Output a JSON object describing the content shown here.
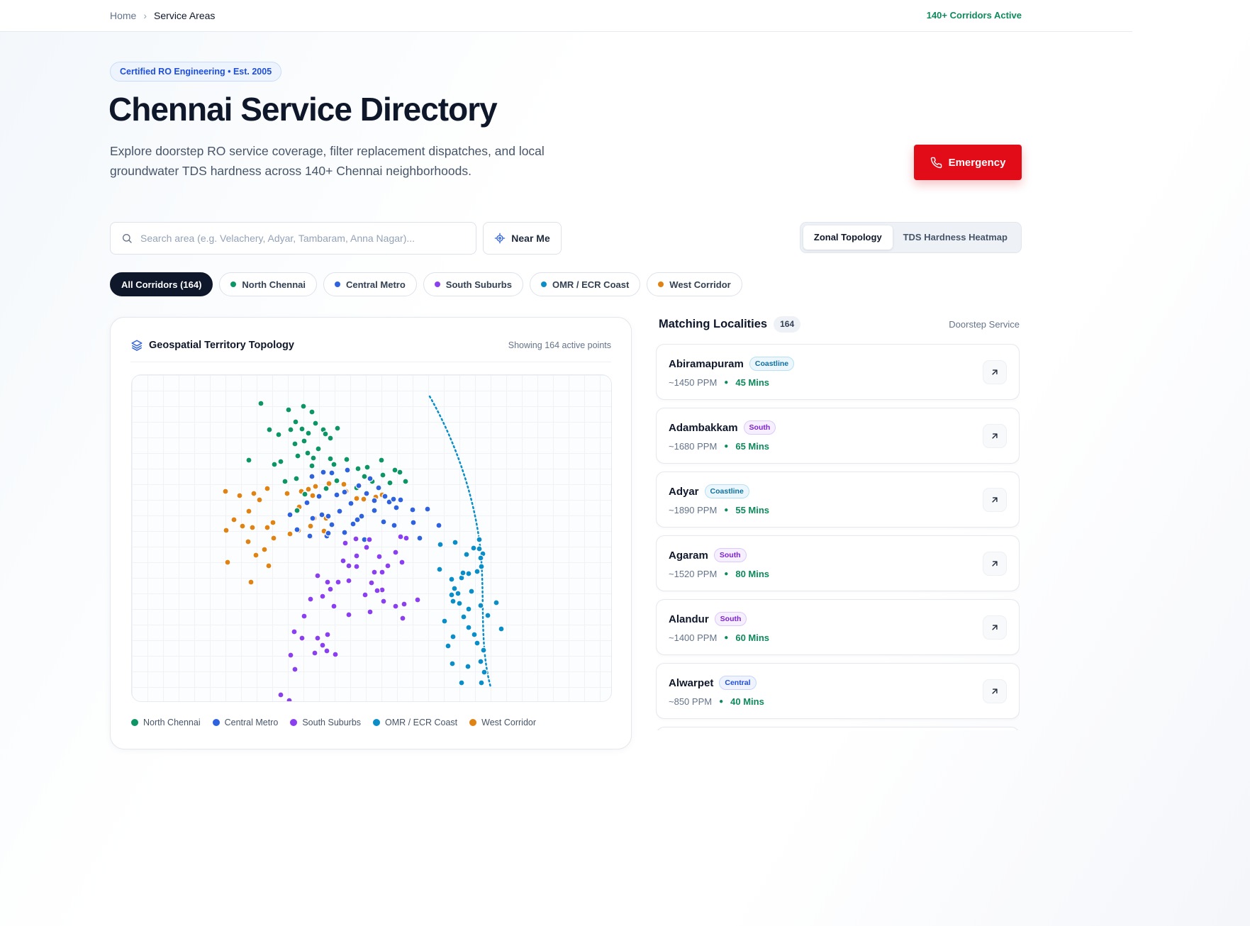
{
  "breadcrumb": {
    "home": "Home",
    "current": "Service Areas"
  },
  "top_status": "140+ Corridors Active",
  "hero": {
    "badge": "Certified RO Engineering • Est. 2005",
    "title": "Chennai Service Directory",
    "subtitle": "Explore doorstep RO service coverage, filter replacement dispatches, and local groundwater TDS hardness across 140+ Chennai neighborhoods.",
    "emergency_label": "Emergency"
  },
  "search": {
    "placeholder": "Search area (e.g. Velachery, Adyar, Tambaram, Anna Nagar)...",
    "value": "",
    "near_me_label": "Near Me"
  },
  "view_toggle": {
    "options": [
      "Zonal Topology",
      "TDS Hardness Heatmap"
    ],
    "selected": "Zonal Topology"
  },
  "filters": [
    {
      "label": "All Corridors (164)",
      "active": true
    },
    {
      "label": "North Chennai",
      "color": "#0e9566"
    },
    {
      "label": "Central Metro",
      "color": "#2f62de"
    },
    {
      "label": "South Suburbs",
      "color": "#8a3ff0"
    },
    {
      "label": "OMR / ECR Coast",
      "color": "#0b8ec8"
    },
    {
      "label": "West Corridor",
      "color": "#de8314"
    }
  ],
  "map": {
    "title": "Geospatial Territory Topology",
    "count_label": "Showing 164 active points",
    "icon": "layers-icon",
    "legend": [
      {
        "label": "North Chennai",
        "color": "#0e9566"
      },
      {
        "label": "Central Metro",
        "color": "#2f62de"
      },
      {
        "label": "South Suburbs",
        "color": "#8a3ff0"
      },
      {
        "label": "OMR / ECR Coast",
        "color": "#0b8ec8"
      },
      {
        "label": "West Corridor",
        "color": "#de8314"
      }
    ]
  },
  "localities": {
    "title": "Matching Localities",
    "count": "164",
    "service_label": "Doorstep Service",
    "items": [
      {
        "name": "Abiramapuram",
        "tag": "Coastline",
        "tag_type": "coast",
        "ppm": "~1450 PPM",
        "eta": "45 Mins"
      },
      {
        "name": "Adambakkam",
        "tag": "South",
        "tag_type": "south",
        "ppm": "~1680 PPM",
        "eta": "65 Mins"
      },
      {
        "name": "Adyar",
        "tag": "Coastline",
        "tag_type": "coast",
        "ppm": "~1890 PPM",
        "eta": "55 Mins"
      },
      {
        "name": "Agaram",
        "tag": "South",
        "tag_type": "south",
        "ppm": "~1520 PPM",
        "eta": "80 Mins"
      },
      {
        "name": "Alandur",
        "tag": "South",
        "tag_type": "south",
        "ppm": "~1400 PPM",
        "eta": "60 Mins"
      },
      {
        "name": "Alwarpet",
        "tag": "Central",
        "tag_type": "central",
        "ppm": "~850 PPM",
        "eta": "40 Mins"
      }
    ]
  },
  "icons": {
    "emergency": "phone-icon",
    "search": "search-icon",
    "near_me": "crosshair-icon",
    "locality_action": "arrow-up-right-icon"
  }
}
